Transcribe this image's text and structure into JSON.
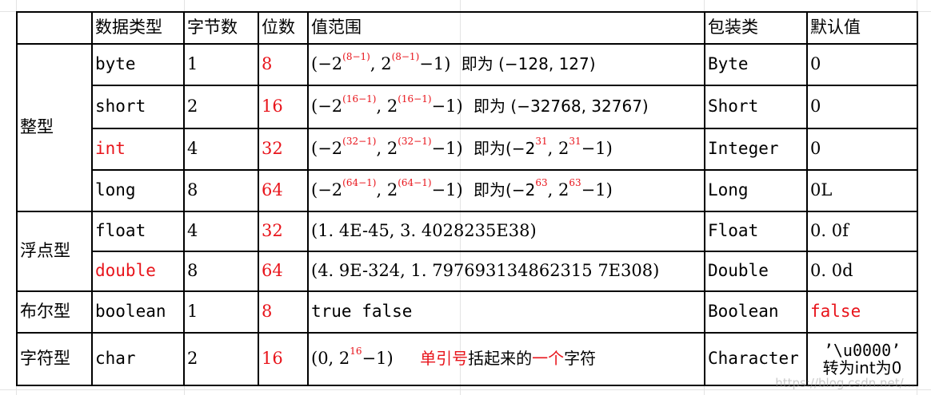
{
  "header": {
    "data_type": "数据类型",
    "bytes": "字节数",
    "bits": "位数",
    "range": "值范围",
    "wrapper": "包装类",
    "default": "默认值"
  },
  "categories": {
    "integer": "整型",
    "float": "浮点型",
    "boolean": "布尔型",
    "char": "字符型"
  },
  "rows": [
    {
      "type": "byte",
      "bytes": "1",
      "bits": "8",
      "neg": "(−2",
      "exp": "(8−1)",
      "mid": ", 2",
      "exp2": "(8−1)",
      "tail": "−1)",
      "note": "即为 (−128, 127)",
      "wrapper": "Byte",
      "default": "0"
    },
    {
      "type": "short",
      "bytes": "2",
      "bits": "16",
      "neg": "(−2",
      "exp": "(16−1)",
      "mid": ", 2",
      "exp2": "(16−1)",
      "tail": "−1)",
      "note": "即为 (−32768, 32767)",
      "wrapper": "Short",
      "default": "0"
    },
    {
      "type": "int",
      "bytes": "4",
      "bits": "32",
      "neg": "(−2",
      "exp": "(32−1)",
      "mid": ", 2",
      "exp2": "(32−1)",
      "tail": "−1)",
      "note_prefix": "即为(−2",
      "note_exp": "31",
      "note_mid": ", 2",
      "note_exp2": "31",
      "note_tail": "−1)",
      "wrapper": "Integer",
      "default": "0"
    },
    {
      "type": "long",
      "bytes": "8",
      "bits": "64",
      "neg": "(−2",
      "exp": "(64−1)",
      "mid": ", 2",
      "exp2": "(64−1)",
      "tail": "−1)",
      "note_prefix": "即为(−2",
      "note_exp": "63",
      "note_mid": ", 2",
      "note_exp2": "63",
      "note_tail": "−1)",
      "wrapper": "Long",
      "default": "0L"
    },
    {
      "type": "float",
      "bytes": "4",
      "bits": "32",
      "range": "(1. 4E-45, 3. 4028235E38)",
      "wrapper": "Float",
      "default": "0. 0f"
    },
    {
      "type": "double",
      "bytes": "8",
      "bits": "64",
      "range": "(4. 9E-324, 1. 797693134862315 7E308)",
      "wrapper": "Double",
      "default": "0. 0d"
    },
    {
      "type": "boolean",
      "bytes": "1",
      "bits": "8",
      "range": "true  false",
      "wrapper": "Boolean",
      "default": "false"
    },
    {
      "type": "char",
      "bytes": "2",
      "bits": "16",
      "range_prefix": "(0, 2",
      "range_exp": "16",
      "range_tail": "−1)",
      "note_red1": "单引号",
      "note_black1": "括起来的",
      "note_red2": "一个",
      "note_black2": "字符",
      "wrapper": "Character",
      "default_line1": "’\\u0000’",
      "default_line2": "转为int为0"
    }
  ],
  "watermark": "https://blog.csdn.net/...",
  "colors": {
    "highlight": "#e8141b",
    "border": "#000000"
  }
}
